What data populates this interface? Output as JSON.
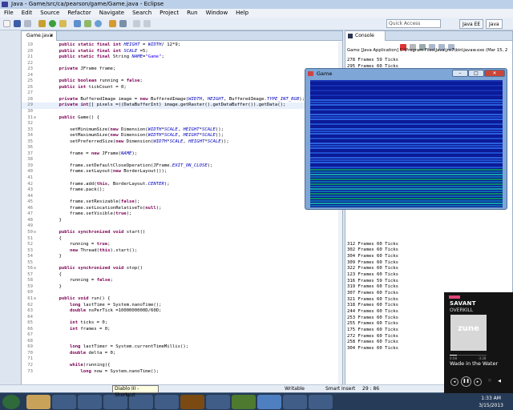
{
  "window": {
    "title": "Java - Game/src/ca/pearson/game/Game.java - Eclipse"
  },
  "menu": [
    "File",
    "Edit",
    "Source",
    "Refactor",
    "Navigate",
    "Search",
    "Project",
    "Run",
    "Window",
    "Help"
  ],
  "toolbar": {
    "quick_access_placeholder": "Quick Access",
    "perspective_java_ee": "Java EE",
    "perspective_java": "Java"
  },
  "editor": {
    "tab_label": "Game.java",
    "lines": [
      {
        "n": "19",
        "fold": "",
        "t": "    public static final int HEIGHT = WIDTH/ 12*9;"
      },
      {
        "n": "20",
        "fold": "",
        "t": "    public static final int SCALE =5;"
      },
      {
        "n": "21",
        "fold": "",
        "t": "    public static final String NAME=\"Game\";"
      },
      {
        "n": "22",
        "fold": "",
        "t": ""
      },
      {
        "n": "23",
        "fold": "",
        "t": "    private JFrame frame;"
      },
      {
        "n": "24",
        "fold": "",
        "t": ""
      },
      {
        "n": "25",
        "fold": "",
        "t": "    public boolean running = false;"
      },
      {
        "n": "26",
        "fold": "",
        "t": "    public int tickCount = 0;"
      },
      {
        "n": "27",
        "fold": "",
        "t": ""
      },
      {
        "n": "28",
        "fold": "",
        "t": "    private BufferedImage image = new BufferedImage(WIDTH, HEIGHT, BufferedImage.TYPE_INT_RGB);"
      },
      {
        "n": "29",
        "fold": "",
        "t": "    private int[] pixels =((DataBufferInt) image.getRaster().getDataBuffer()).getData();"
      },
      {
        "n": "30",
        "fold": "",
        "t": ""
      },
      {
        "n": "31",
        "fold": "⊖",
        "t": "    public Game() {"
      },
      {
        "n": "32",
        "fold": "",
        "t": ""
      },
      {
        "n": "33",
        "fold": "",
        "t": "        setMinimumSize(new Dimension(WIDTH*SCALE, HEIGHT*SCALE));"
      },
      {
        "n": "34",
        "fold": "",
        "t": "        setMaximumSize(new Dimension(WIDTH*SCALE, HEIGHT*SCALE));"
      },
      {
        "n": "35",
        "fold": "",
        "t": "        setPreferredSize(new Dimension(WIDTH*SCALE, HEIGHT*SCALE));"
      },
      {
        "n": "36",
        "fold": "",
        "t": ""
      },
      {
        "n": "37",
        "fold": "",
        "t": "        frame = new JFrame(NAME);"
      },
      {
        "n": "38",
        "fold": "",
        "t": ""
      },
      {
        "n": "39",
        "fold": "",
        "t": "        frame.setDefaultCloseOperation(JFrame.EXIT_ON_CLOSE);"
      },
      {
        "n": "40",
        "fold": "",
        "t": "        frame.setLayout(new BorderLayout());"
      },
      {
        "n": "41",
        "fold": "",
        "t": ""
      },
      {
        "n": "42",
        "fold": "",
        "t": "        frame.add(this, BorderLayout.CENTER);"
      },
      {
        "n": "43",
        "fold": "",
        "t": "        frame.pack();"
      },
      {
        "n": "44",
        "fold": "",
        "t": ""
      },
      {
        "n": "45",
        "fold": "",
        "t": "        frame.setResizable(false);"
      },
      {
        "n": "46",
        "fold": "",
        "t": "        frame.setLocationRelativeTo(null);"
      },
      {
        "n": "47",
        "fold": "",
        "t": "        frame.setVisible(true);"
      },
      {
        "n": "48",
        "fold": "",
        "t": "    }"
      },
      {
        "n": "49",
        "fold": "",
        "t": ""
      },
      {
        "n": "50",
        "fold": "⊖",
        "t": "    public synchronized void start()"
      },
      {
        "n": "51",
        "fold": "",
        "t": "    {"
      },
      {
        "n": "52",
        "fold": "",
        "t": "        running = true;"
      },
      {
        "n": "53",
        "fold": "",
        "t": "        new Thread(this).start();"
      },
      {
        "n": "54",
        "fold": "",
        "t": "    }"
      },
      {
        "n": "55",
        "fold": "",
        "t": ""
      },
      {
        "n": "56",
        "fold": "⊖",
        "t": "    public synchronized void stop()"
      },
      {
        "n": "57",
        "fold": "",
        "t": "    {"
      },
      {
        "n": "58",
        "fold": "",
        "t": "        running = false;"
      },
      {
        "n": "59",
        "fold": "",
        "t": "    }"
      },
      {
        "n": "60",
        "fold": "",
        "t": ""
      },
      {
        "n": "61",
        "fold": "⊖",
        "t": "    public void run() {"
      },
      {
        "n": "62",
        "fold": "",
        "t": "        long lastTime = System.nanoTime();"
      },
      {
        "n": "63",
        "fold": "",
        "t": "        double nsPerTick =1000000000D/60D;"
      },
      {
        "n": "64",
        "fold": "",
        "t": ""
      },
      {
        "n": "65",
        "fold": "",
        "t": "        int ticks = 0;"
      },
      {
        "n": "66",
        "fold": "",
        "t": "        int frames = 0;"
      },
      {
        "n": "67",
        "fold": "",
        "t": ""
      },
      {
        "n": "68",
        "fold": "",
        "t": ""
      },
      {
        "n": "69",
        "fold": "",
        "t": "        long lastTimer = System.currentTimeMillis();"
      },
      {
        "n": "70",
        "fold": "",
        "t": "        double delta = 0;"
      },
      {
        "n": "71",
        "fold": "",
        "t": ""
      },
      {
        "n": "72",
        "fold": "",
        "t": "        while(running){"
      },
      {
        "n": "73",
        "fold": "",
        "t": "            long now = System.nanoTime();"
      }
    ]
  },
  "console": {
    "tab_label": "Console",
    "description": "Game [Java Application] C:\\Program Files\\Java\\jre7\\bin\\javaw.exe (Mar 15, 2",
    "lines": [
      "278 Frames 59 Ticks",
      "295 Frames 60 Ticks",
      "",
      "",
      "",
      "",
      "",
      "",
      "",
      "",
      "",
      "",
      "",
      "",
      "",
      "",
      "",
      "",
      "",
      "",
      "",
      "",
      "",
      "",
      "",
      "",
      "",
      "",
      "",
      "",
      "312 Frames 60 Ticks",
      "302 Frames 60 Ticks",
      "304 Frames 60 Ticks",
      "309 Frames 60 Ticks",
      "322 Frames 60 Ticks",
      "123 Frames 60 Ticks",
      "316 Frames 59 Ticks",
      "319 Frames 60 Ticks",
      "307 Frames 60 Ticks",
      "321 Frames 60 Ticks",
      "318 Frames 60 Ticks",
      "244 Frames 60 Ticks",
      "253 Frames 60 Ticks",
      "255 Frames 60 Ticks",
      "175 Frames 60 Ticks",
      "272 Frames 60 Ticks",
      "258 Frames 60 Ticks",
      "304 Frames 60 Ticks"
    ]
  },
  "game_window": {
    "title": "Game"
  },
  "status": {
    "writable": "Writable",
    "insert_mode": "Smart Insert",
    "position": "29 : 86"
  },
  "taskbar": {
    "tooltip": "Diablo III - Shortcut",
    "time": "1:33 AM",
    "date": "3/15/2013"
  },
  "zune": {
    "artist": "SAVANT",
    "album": "OVERKILL",
    "logo": "zune",
    "song": "Wade in the Water",
    "progress": 0.2,
    "elapsed": "0:08",
    "remaining": "-3:28"
  }
}
